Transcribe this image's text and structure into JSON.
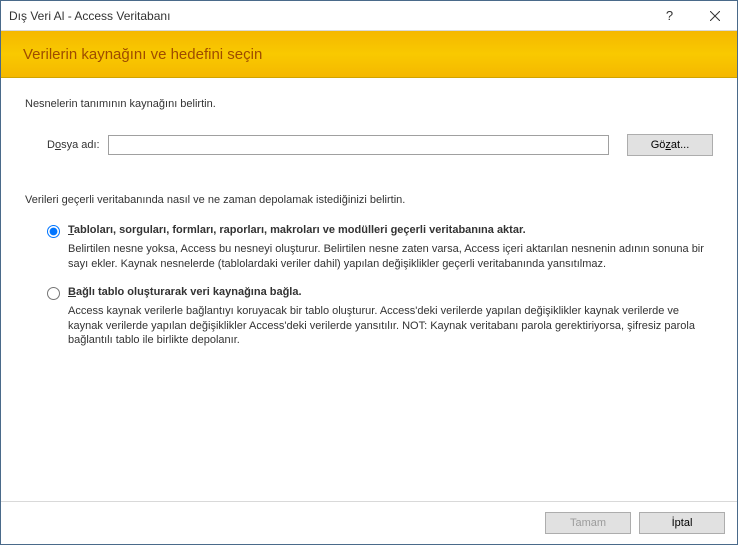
{
  "titlebar": {
    "title": "Dış Veri Al - Access Veritabanı",
    "help_label": "?",
    "close_label": "×"
  },
  "banner": {
    "heading": "Verilerin kaynağını ve hedefini seçin"
  },
  "content": {
    "instruction": "Nesnelerin tanımının kaynağını belirtin.",
    "file_label_pre": "D",
    "file_label_u": "o",
    "file_label_post": "sya adı:",
    "file_value": "",
    "browse_pre": "Gö",
    "browse_u": "z",
    "browse_post": "at...",
    "section_label": "Verileri geçerli veritabanında nasıl ve ne zaman depolamak istediğinizi belirtin.",
    "options": [
      {
        "checked": true,
        "label_u": "T",
        "label_rest": "abloları, sorguları, formları, raporları, makroları ve modülleri geçerli veritabanına aktar.",
        "desc": "Belirtilen nesne yoksa, Access bu nesneyi oluşturur. Belirtilen nesne zaten varsa, Access içeri aktarılan nesnenin adının sonuna bir sayı ekler. Kaynak nesnelerde (tablolardaki veriler dahil) yapılan değişiklikler geçerli veritabanında yansıtılmaz."
      },
      {
        "checked": false,
        "label_u": "B",
        "label_rest": "ağlı tablo oluşturarak veri kaynağına bağla.",
        "desc": "Access kaynak verilerle bağlantıyı koruyacak bir tablo oluşturur. Access'deki verilerde yapılan değişiklikler kaynak verilerde ve kaynak verilerde yapılan değişiklikler Access'deki verilerde yansıtılır. NOT: Kaynak veritabanı parola gerektiriyorsa, şifresiz parola bağlantılı tablo ile birlikte depolanır."
      }
    ]
  },
  "footer": {
    "ok": "Tamam",
    "cancel": "İptal"
  }
}
